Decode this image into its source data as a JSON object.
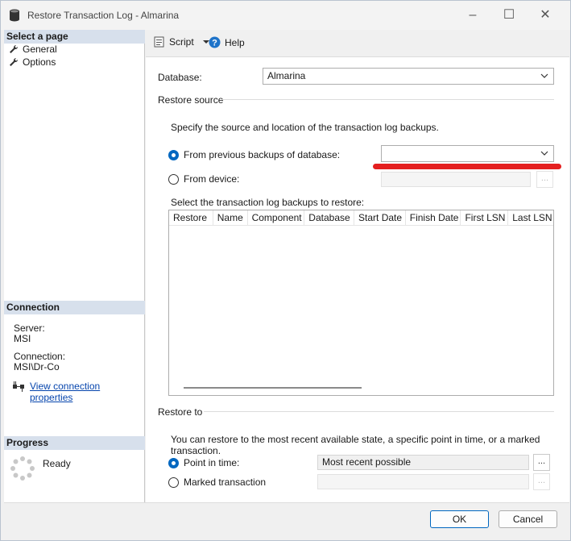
{
  "window": {
    "title": "Restore Transaction Log  -  Almarina"
  },
  "left_pane": {
    "select_page_header": "Select a page",
    "pages": [
      {
        "label": "General"
      },
      {
        "label": "Options"
      }
    ],
    "connection_header": "Connection",
    "server_label": "Server:",
    "server_value": "MSI",
    "connection_label": "Connection:",
    "connection_value": "MSI\\Dr-Co",
    "view_properties_link": "View connection properties",
    "progress_header": "Progress",
    "progress_status": "Ready"
  },
  "toolbar": {
    "script_label": "Script",
    "help_label": "Help"
  },
  "general": {
    "database_label": "Database:",
    "database_value": "Almarina",
    "restore_source_label": "Restore source",
    "source_instructions": "Specify the source and location of the transaction log backups.",
    "from_previous_label": "From previous backups of database:",
    "from_previous_value": "",
    "from_device_label": "From device:",
    "device_browse_label": "...",
    "select_backups_label": "Select the transaction log backups to restore:",
    "grid_columns": [
      "Restore",
      "Name",
      "Component",
      "Database",
      "Start Date",
      "Finish Date",
      "First LSN",
      "Last LSN"
    ],
    "restore_to_label": "Restore to",
    "restore_to_instructions": "You can restore to the most recent available state, a specific point in time, or a marked transaction.",
    "point_in_time_label": "Point in time:",
    "point_in_time_value": "Most recent possible",
    "point_browse_label": "...",
    "marked_transaction_label": "Marked transaction",
    "marked_browse_label": "..."
  },
  "footer": {
    "ok_label": "OK",
    "cancel_label": "Cancel"
  },
  "colors": {
    "accent": "#0067c0",
    "annotation": "#e41f1f",
    "header_bg": "#d7e0ec"
  }
}
